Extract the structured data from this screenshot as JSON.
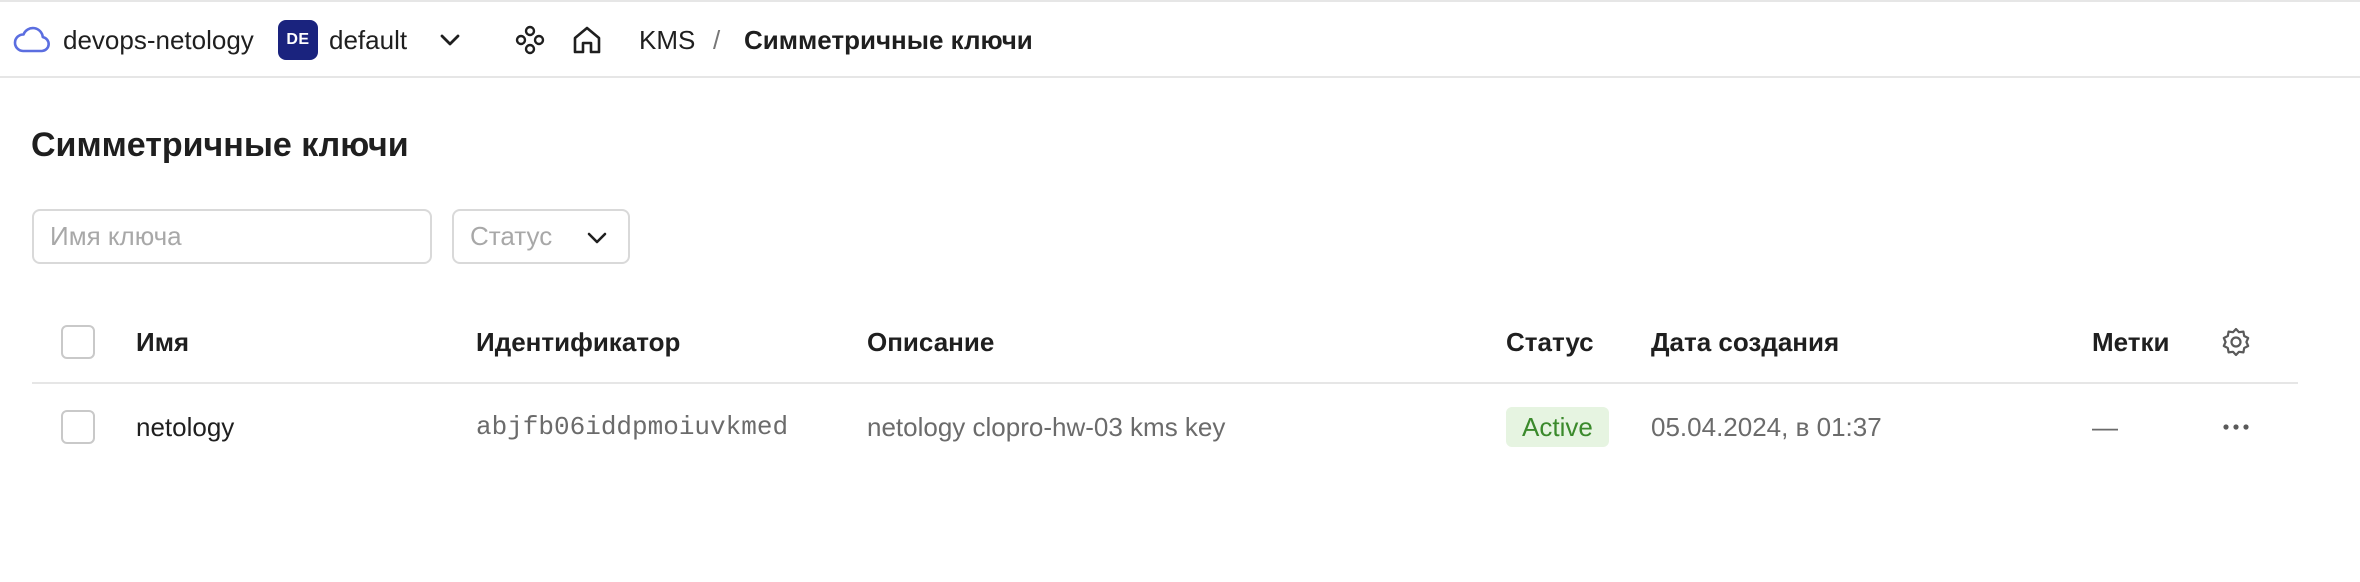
{
  "header": {
    "org_name": "devops-netology",
    "folder_badge": "DE",
    "folder_name": "default",
    "breadcrumb_service": "KMS",
    "breadcrumb_separator": "/",
    "breadcrumb_current": "Симметричные ключи",
    "icons": [
      "cloud-icon",
      "chevron-down-icon",
      "services-icon",
      "home-icon"
    ]
  },
  "page": {
    "title": "Симметричные ключи"
  },
  "filters": {
    "search_placeholder": "Имя ключа",
    "search_value": "",
    "status_placeholder": "Статус"
  },
  "table": {
    "columns": [
      "Имя",
      "Идентификатор",
      "Описание",
      "Статус",
      "Дата создания",
      "Метки"
    ],
    "rows": [
      {
        "name": "netology",
        "id": "abjfb06iddpmoiuvkmed",
        "description": "netology clopro-hw-03 kms key",
        "status": "Active",
        "created": "05.04.2024, в 01:37",
        "labels": "—"
      }
    ]
  },
  "colors": {
    "accent_badge": "#1a237e",
    "status_active_bg": "#e6f4e1",
    "status_active_text": "#3b8a2c",
    "cloud_icon": "#5b6ee0"
  }
}
